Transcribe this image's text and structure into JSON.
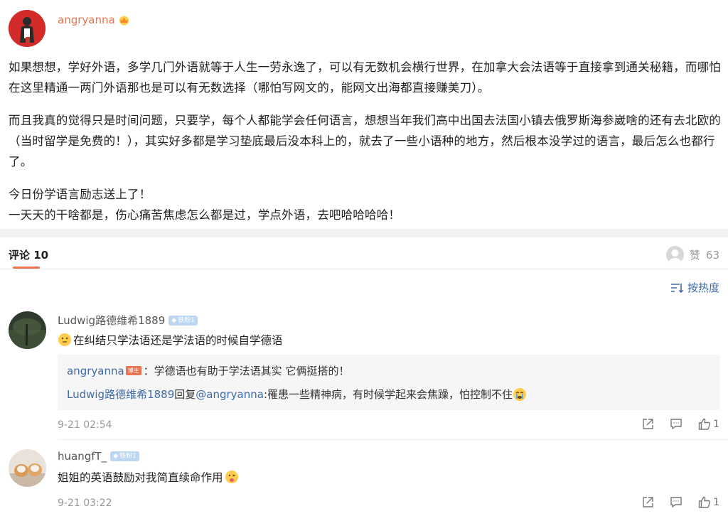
{
  "post": {
    "author": "angryanna",
    "paragraphs": [
      "如果想想，学好外语，多学几门外语就等于人生一劳永逸了，可以有无数机会横行世界，在加拿大会法语等于直接拿到通关秘籍，而哪怕在这里精通一两门外语那也是可以有无数选择（哪怕写网文的，能网文出海都直接赚美刀）。",
      "而且我真的觉得只是时间问题，只要学，每个人都能学会任何语言，想想当年我们高中出国去法国小镇去俄罗斯海参崴啥的还有去北欧的（当时留学是免费的！），其实好多都是学习垫底最后没本科上的，就去了一些小语种的地方，然后根本没学过的语言，最后怎么也都行了。",
      "今日份学语言励志送上了！",
      "一天天的干啥都是，伤心痛苦焦虑怎么都是过，学点外语，去吧哈哈哈哈！"
    ]
  },
  "comments_header": {
    "tab_label": "评论 10",
    "like_label": "赞",
    "like_count": "63",
    "sort_label": "按热度"
  },
  "comments": [
    {
      "user": "Ludwig路德维希1889",
      "badge": "铁粉1",
      "text": "在纠结只学法语还是学法语的时候自学德语",
      "emoji_icon": "thinking-face-icon",
      "replies": {
        "r1_user": "angryanna",
        "r1_badge": "博主",
        "r1_text": "：学德语也有助于学法语其实 它俩挺搭的！",
        "r2_user": "Ludwig路德维希1889",
        "r2_verb": " 回复 ",
        "r2_target": "@angryanna",
        "r2_text": ":罹患一些精神病，有时候学起来会焦躁，怕控制不住",
        "r2_emoji_icon": "crying-face-icon"
      },
      "time": "9-21 02:54",
      "like_count": "1"
    },
    {
      "user": "huangfT_",
      "badge": "铁粉1",
      "text": "姐姐的英语鼓励对我简直续命作用",
      "emoji_icon": "face-with-tongue-icon",
      "time": "9-21 03:22",
      "like_count": "1"
    }
  ],
  "colors": {
    "brand": "#eb7350",
    "link": "#3f6ba5",
    "fan_badge": "#bcd7f3"
  }
}
